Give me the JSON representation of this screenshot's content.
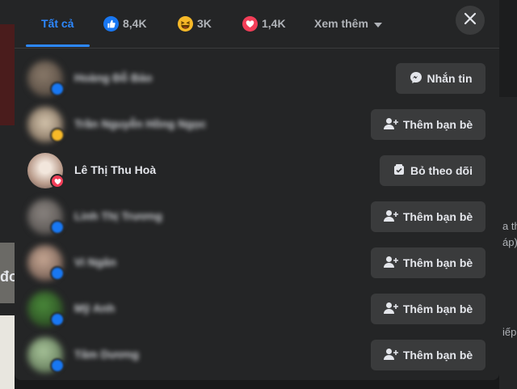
{
  "tabs": {
    "all": "Tất cả",
    "like_count": "8,4K",
    "haha_count": "3K",
    "love_count": "1,4K",
    "more": "Xem thêm"
  },
  "people": [
    {
      "name": "Hoàng Đỗ Bảo",
      "button": "Nhắn tin",
      "icon": "messenger-icon",
      "blurred": true
    },
    {
      "name": "Trần Nguyễn Hồng Ngọc",
      "button": "Thêm bạn bè",
      "icon": "add-friend-icon",
      "blurred": true
    },
    {
      "name": "Lê Thị Thu Hoà",
      "button": "Bỏ theo dõi",
      "icon": "unfollow-icon",
      "blurred": false
    },
    {
      "name": "Linh Thị Trương",
      "button": "Thêm bạn bè",
      "icon": "add-friend-icon",
      "blurred": true
    },
    {
      "name": "Vi Ngân",
      "button": "Thêm bạn bè",
      "icon": "add-friend-icon",
      "blurred": true
    },
    {
      "name": "Mỹ Anh",
      "button": "Thêm bạn bè",
      "icon": "add-friend-icon",
      "blurred": true
    },
    {
      "name": "Tâm Dương",
      "button": "Thêm bạn bè",
      "icon": "add-friend-icon",
      "blurred": true
    }
  ],
  "background_text": {
    "right_1": "a th",
    "right_2": "áp)",
    "right_3": "iếp",
    "left_1": "đơ"
  },
  "colors": {
    "accent": "#2d88ff",
    "like": "#1877f2",
    "haha": "#f7b928",
    "love": "#f33e58",
    "modal_bg": "#242526",
    "button_bg": "#3a3b3c"
  }
}
